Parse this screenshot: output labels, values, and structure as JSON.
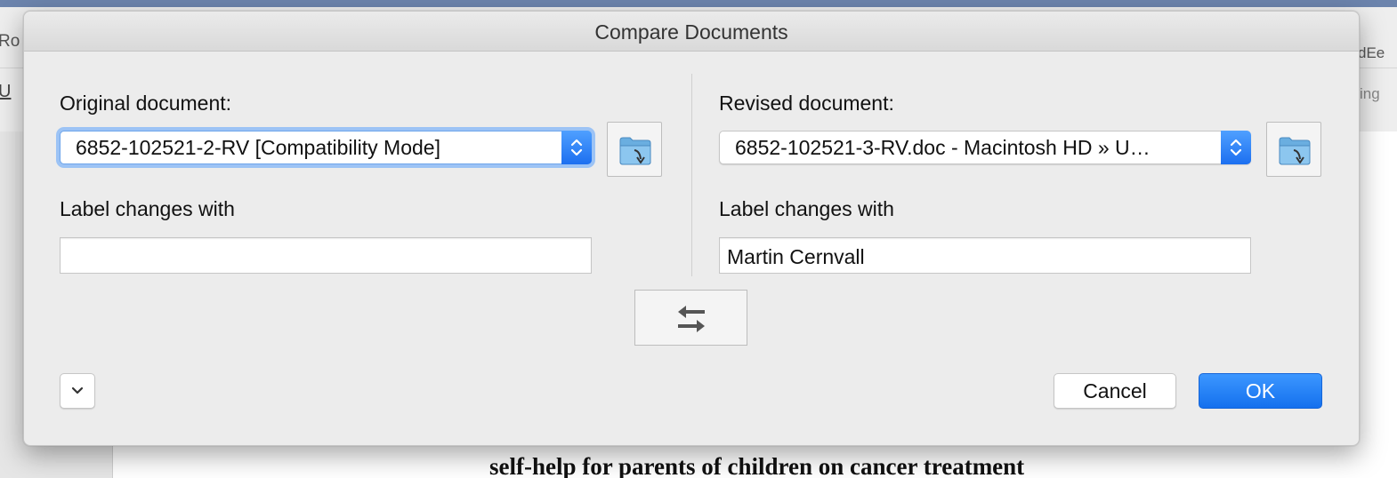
{
  "background": {
    "left_fragment": "Ro",
    "right_fragment_1": "dEe",
    "right_fragment_2": "ing",
    "document_heading": "self-help for parents of children on cancer treatment"
  },
  "dialog": {
    "title": "Compare Documents",
    "original": {
      "label": "Original document:",
      "selected": "6852-102521-2-RV [Compatibility Mode]",
      "label_changes_with": "Label changes with",
      "label_value": ""
    },
    "revised": {
      "label": "Revised document:",
      "selected": "6852-102521-3-RV.doc - Macintosh HD » U…",
      "label_changes_with": "Label changes with",
      "label_value": "Martin Cernvall"
    },
    "buttons": {
      "cancel": "Cancel",
      "ok": "OK"
    },
    "icons": {
      "folder": "folder-open-icon",
      "swap": "swap-arrows-icon",
      "disclosure": "chevron-down-icon",
      "popup": "updown-arrows-icon"
    },
    "colors": {
      "accent": "#1c6ff0",
      "focus_ring": "#9cc3f5"
    }
  }
}
